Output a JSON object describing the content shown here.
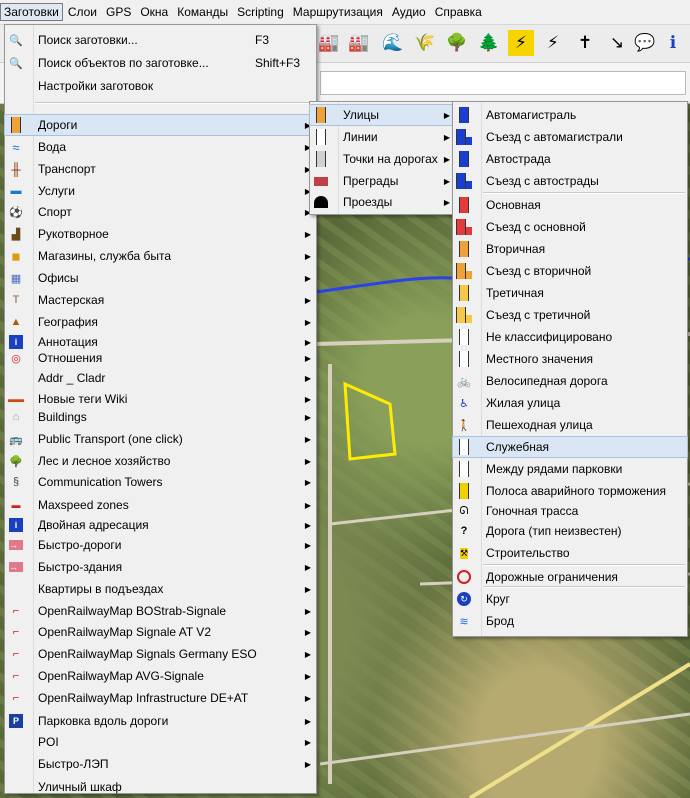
{
  "menubar": [
    "Заготовки",
    "Слои",
    "GPS",
    "Окна",
    "Команды",
    "Scripting",
    "Маршрутизация",
    "Аудио",
    "Справка"
  ],
  "presets_top": [
    {
      "label": "Поиск заготовки...",
      "shortcut": "F3",
      "icon": "search-icon"
    },
    {
      "label": "Поиск объектов по заготовке...",
      "shortcut": "Shift+F3",
      "icon": "search-objects-icon"
    },
    {
      "label": "Настройки заготовок",
      "shortcut": "",
      "icon": ""
    }
  ],
  "main_items": [
    {
      "label": "Дороги",
      "icon": "road-icon",
      "arrow": true
    },
    {
      "label": "Вода",
      "icon": "water-icon",
      "arrow": true
    },
    {
      "label": "Транспорт",
      "icon": "railway-icon",
      "arrow": true
    },
    {
      "label": "Услуги",
      "icon": "bed-icon",
      "arrow": true
    },
    {
      "label": "Спорт",
      "icon": "ball-icon",
      "arrow": true
    },
    {
      "label": "Рукотворное",
      "icon": "factory-icon",
      "arrow": true
    },
    {
      "label": "Магазины, служба быта",
      "icon": "shop-icon",
      "arrow": true
    },
    {
      "label": "Офисы",
      "icon": "office-icon",
      "arrow": true
    },
    {
      "label": "Мастерская",
      "icon": "hammer-icon",
      "arrow": true
    },
    {
      "label": "География",
      "icon": "mountain-icon",
      "arrow": true
    },
    {
      "label": "Аннотация",
      "icon": "info-icon",
      "arrow": true
    },
    {
      "label": "Отношения",
      "icon": "relation-icon",
      "arrow": true
    },
    {
      "label": "Addr _ Cladr",
      "icon": "",
      "arrow": true
    },
    {
      "label": "Новые теги Wiki",
      "icon": "wiki-tags-icon",
      "arrow": true
    },
    {
      "label": "Buildings",
      "icon": "building-icon",
      "arrow": true
    },
    {
      "label": "Public Transport (one click)",
      "icon": "bus-icon",
      "arrow": true
    },
    {
      "label": "Лес и лесное хозяйство",
      "icon": "forest-icon",
      "arrow": true
    },
    {
      "label": "Communication Towers",
      "icon": "tower-icon",
      "arrow": true
    },
    {
      "label": "Maxspeed zones",
      "icon": "maxspeed-icon",
      "arrow": true
    },
    {
      "label": "Двойная адресация",
      "icon": "info-icon",
      "arrow": true
    },
    {
      "label": "Быстро-дороги",
      "icon": "arrow-right-icon",
      "arrow": true
    },
    {
      "label": "Быстро-здания",
      "icon": "arrow-right-icon",
      "arrow": true
    },
    {
      "label": "Квартиры в подъездах",
      "icon": "",
      "arrow": true
    },
    {
      "label": "OpenRailwayMap BOStrab-Signale",
      "icon": "signal-icon",
      "arrow": true
    },
    {
      "label": "OpenRailwayMap Signale AT V2",
      "icon": "signal-icon",
      "arrow": true
    },
    {
      "label": "OpenRailwayMap Signals Germany ESO",
      "icon": "signal-icon",
      "arrow": true
    },
    {
      "label": "OpenRailwayMap AVG-Signale",
      "icon": "signal-icon",
      "arrow": true
    },
    {
      "label": "OpenRailwayMap Infrastructure DE+AT",
      "icon": "signal-icon",
      "arrow": true
    },
    {
      "label": "Парковка вдоль дороги",
      "icon": "parking-icon",
      "arrow": true
    },
    {
      "label": "POI",
      "icon": "",
      "arrow": true
    },
    {
      "label": "Быстро-ЛЭП",
      "icon": "",
      "arrow": true
    },
    {
      "label": "Уличный шкаф",
      "icon": "",
      "arrow": false
    }
  ],
  "roads_submenu": [
    {
      "label": "Улицы",
      "icon": "street-icon",
      "arrow": true
    },
    {
      "label": "Линии",
      "icon": "lines-icon",
      "arrow": true
    },
    {
      "label": "Точки на дорогах",
      "icon": "road-point-icon",
      "arrow": true
    },
    {
      "label": "Преграды",
      "icon": "barrier-icon",
      "arrow": true
    },
    {
      "label": "Проезды",
      "icon": "tunnel-icon",
      "arrow": true
    }
  ],
  "streets_submenu": [
    {
      "label": "Автомагистраль",
      "icon": "motorway-icon",
      "group": 1
    },
    {
      "label": "Съезд с автомагистрали",
      "icon": "motorway-link-icon",
      "group": 1
    },
    {
      "label": "Автострада",
      "icon": "trunk-icon",
      "group": 1
    },
    {
      "label": "Съезд с автострады",
      "icon": "trunk-link-icon",
      "group": 1
    },
    {
      "label": "Основная",
      "icon": "primary-icon",
      "group": 2
    },
    {
      "label": "Съезд с основной",
      "icon": "primary-link-icon",
      "group": 2
    },
    {
      "label": "Вторичная",
      "icon": "secondary-icon",
      "group": 2
    },
    {
      "label": "Съезд с вторичной",
      "icon": "secondary-link-icon",
      "group": 2
    },
    {
      "label": "Третичная",
      "icon": "tertiary-icon",
      "group": 2
    },
    {
      "label": "Съезд с третичной",
      "icon": "tertiary-link-icon",
      "group": 2
    },
    {
      "label": "Не классифицировано",
      "icon": "unclassified-icon",
      "group": 2
    },
    {
      "label": "Местного значения",
      "icon": "residential-icon",
      "group": 2
    },
    {
      "label": "Велосипедная дорога",
      "icon": "bicycle-icon",
      "group": 2
    },
    {
      "label": "Жилая улица",
      "icon": "living-street-icon",
      "group": 2
    },
    {
      "label": "Пешеходная улица",
      "icon": "pedestrian-icon",
      "group": 2
    },
    {
      "label": "Служебная",
      "icon": "service-icon",
      "group": 2
    },
    {
      "label": "Между рядами парковки",
      "icon": "parking-aisle-icon",
      "group": 2
    },
    {
      "label": "Полоса аварийного торможения",
      "icon": "escape-lane-icon",
      "group": 2
    },
    {
      "label": "Гоночная трасса",
      "icon": "raceway-icon",
      "group": 2
    },
    {
      "label": "Дорога (тип неизвестен)",
      "icon": "unknown-road-icon",
      "group": 2
    },
    {
      "label": "Строительство",
      "icon": "construction-icon",
      "group": 2
    },
    {
      "label": "Дорожные ограничения",
      "icon": "restriction-icon",
      "group": 3
    },
    {
      "label": "Круг",
      "icon": "roundabout-icon",
      "group": 4
    },
    {
      "label": "Брод",
      "icon": "ford-icon",
      "group": 4
    }
  ],
  "colors": {
    "menu_bg": "#f0f0f0",
    "highlight": "#dbe6f4",
    "motorway": "#1a3fd0",
    "primary": "#e23b3b",
    "secondary": "#f0a23a",
    "tertiary": "#f6c84a"
  }
}
